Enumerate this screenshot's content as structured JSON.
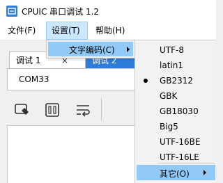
{
  "window": {
    "title": "CPUIC 串口调试 1.2"
  },
  "menubar": [
    {
      "label": "文件(F)"
    },
    {
      "label": "设置(T)"
    },
    {
      "label": "帮助(H)"
    }
  ],
  "tabs": [
    {
      "label": "调试 1",
      "close": "×"
    },
    {
      "label": "调试 2"
    }
  ],
  "port": {
    "value": "COM33"
  },
  "settings_menu": {
    "items": [
      {
        "label": "文字编码(C)"
      }
    ]
  },
  "encoding_menu": {
    "items": [
      {
        "label": "UTF-8",
        "checked": false
      },
      {
        "label": "latin1",
        "checked": false
      },
      {
        "label": "GB2312",
        "checked": true
      },
      {
        "label": "GBK",
        "checked": false
      },
      {
        "label": "GB18030",
        "checked": false
      },
      {
        "label": "Big5",
        "checked": false
      },
      {
        "label": "UTF-16BE",
        "checked": false
      },
      {
        "label": "UTF-16LE",
        "checked": false
      }
    ],
    "other": {
      "label": "其它(O)"
    }
  },
  "colors": {
    "accent": "#2e7dd8",
    "menu_highlight": "#91c9f7",
    "menubar_active": "#cce8ff"
  }
}
